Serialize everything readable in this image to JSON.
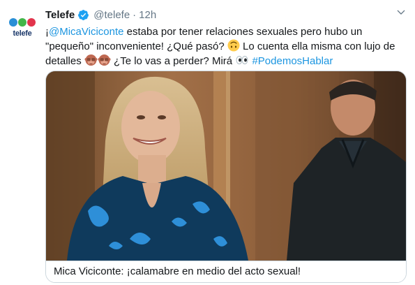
{
  "account": {
    "avatar_wordmark": "telefe",
    "name": "Telefe",
    "handle": "@telefe",
    "separator": "·",
    "time": "12h"
  },
  "tweet": {
    "part1": "¡",
    "mention": "@MicaViciconte",
    "part2": " estaba por tener relaciones sexuales pero hubo un \"pequeño\" inconveniente! ¿Qué pasó? ",
    "part3": " Lo cuenta ella misma con lujo de detalles ",
    "part4": " ¿Te lo vas a perder? Mirá ",
    "hashtag": "#PodemosHablar"
  },
  "card": {
    "caption": "Mica Viciconte: ¡calamabre en medio del acto sexual!"
  },
  "icons": [
    "verified-badge-icon",
    "chevron-down-icon",
    "upside-down-face-emoji",
    "see-no-evil-monkey-emoji",
    "eyes-emoji"
  ],
  "colors": {
    "link": "#1b95e0",
    "verified": "#1da1f2",
    "muted": "#657786",
    "border": "#ccd6dd"
  }
}
